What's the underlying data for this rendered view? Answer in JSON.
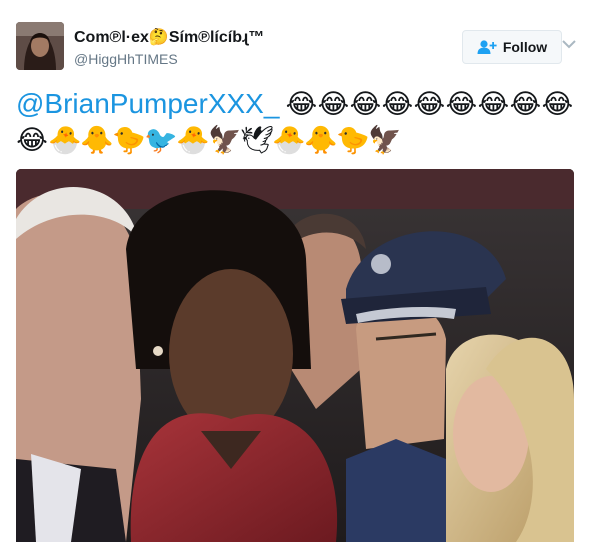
{
  "author": {
    "display_name": "Com℗l·ex🤔Sím℗lícíbɻ™",
    "handle": "@HiggHhTIMES"
  },
  "actions": {
    "follow_label": "Follow",
    "follow_icon": "add-user-icon",
    "menu_icon": "chevron-down-icon"
  },
  "tweet": {
    "mention": "@BrianPumperXXX_",
    "emojis": [
      "😂",
      "😂",
      "😂",
      "😂",
      "😂",
      "😂",
      "😂",
      "😂",
      "😂",
      "😂",
      "🐣",
      "🐥",
      "🐤",
      "🐦",
      "🐣",
      "🦅",
      "🕊",
      "🐣",
      "🐥",
      "🐤",
      "🦅"
    ]
  },
  "colors": {
    "link": "#1b95e0",
    "secondary_text": "#657786",
    "button_border": "#e1e8ed",
    "button_bg": "#f5f8fa"
  }
}
